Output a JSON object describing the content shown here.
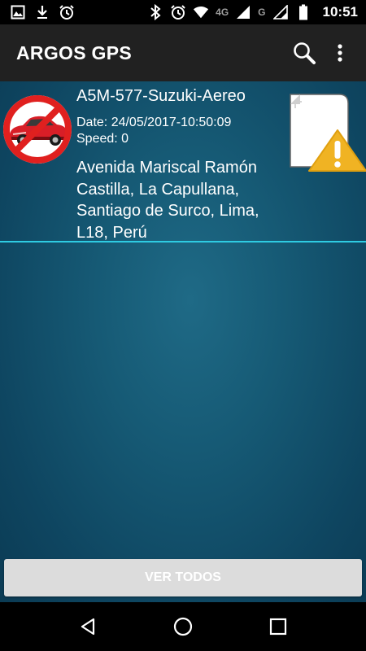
{
  "status_bar": {
    "time": "10:51",
    "network_primary": "4G",
    "network_secondary": "G",
    "icons_left": [
      "image-icon",
      "download-icon",
      "alarm-icon"
    ],
    "icons_right": [
      "bluetooth-icon",
      "alarm-icon",
      "wifi-icon",
      "signal-icon",
      "battery-icon"
    ]
  },
  "app_bar": {
    "title": "ARGOS GPS",
    "actions": [
      "search-icon",
      "overflow-menu-icon"
    ]
  },
  "vehicle": {
    "name": "A5M-577-Suzuki-Aereo",
    "date": "Date: 24/05/2017-10:50:09",
    "speed": "Speed: 0",
    "address": "Avenida Mariscal Ramón Castilla, La Capullana, Santiago de Surco, Lima, L18, Perú",
    "status_icon": "warning-file-icon"
  },
  "footer": {
    "button_label": "VER TODOS"
  },
  "nav_bar": {
    "buttons": [
      "back-icon",
      "home-icon",
      "recents-icon"
    ]
  }
}
